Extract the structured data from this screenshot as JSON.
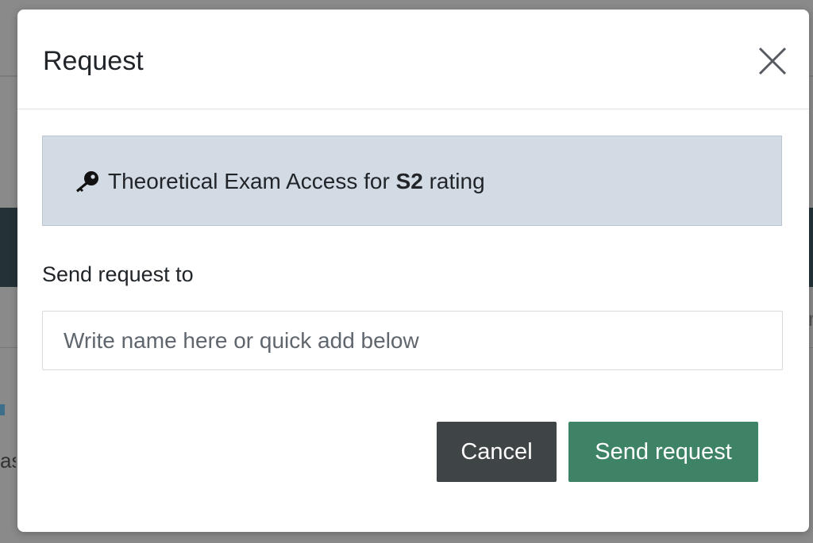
{
  "modal": {
    "title": "Request",
    "close_icon": "close-icon",
    "info": {
      "icon": "key-icon",
      "text_before": "Theoretical Exam Access for ",
      "rating": "S2",
      "text_after": " rating"
    },
    "send_to_label": "Send request to",
    "recipient_input": {
      "value": "",
      "placeholder": "Write name here or quick add below"
    },
    "buttons": {
      "cancel": "Cancel",
      "send": "Send request"
    }
  },
  "background": {
    "left_fragment": "as",
    "right_fragment": "r"
  },
  "colors": {
    "info_bg": "#d2dbe3",
    "cancel_bg": "#3f4446",
    "send_bg": "#3f8366",
    "overlay": "#8a8a8a"
  }
}
